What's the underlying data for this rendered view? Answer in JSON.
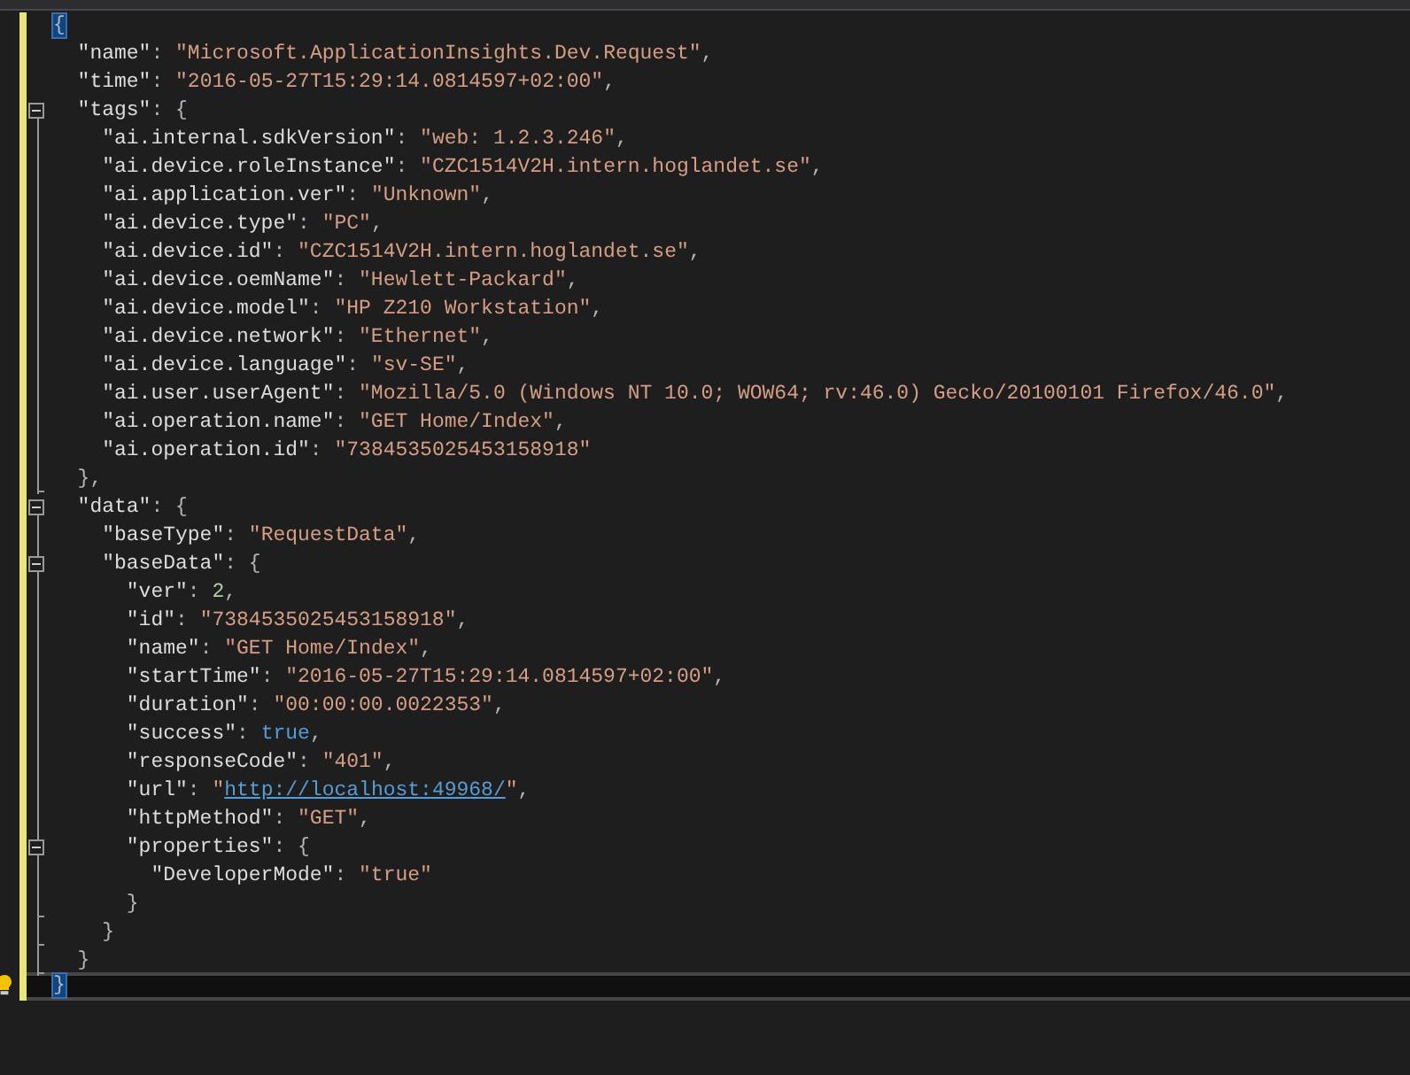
{
  "editor": {
    "root": {
      "tokens": [
        {
          "kind": "punct",
          "text": "{",
          "matched": true
        }
      ],
      "children": [
        {
          "tokens": [
            {
              "kind": "key",
              "text": "\"name\""
            },
            {
              "kind": "punct",
              "text": ": "
            },
            {
              "kind": "string",
              "text": "\"Microsoft.ApplicationInsights.Dev.Request\""
            },
            {
              "kind": "punct",
              "text": ","
            }
          ]
        },
        {
          "tokens": [
            {
              "kind": "key",
              "text": "\"time\""
            },
            {
              "kind": "punct",
              "text": ": "
            },
            {
              "kind": "string",
              "text": "\"2016-05-27T15:29:14.0814597+02:00\""
            },
            {
              "kind": "punct",
              "text": ","
            }
          ]
        },
        {
          "tokens": [
            {
              "kind": "key",
              "text": "\"tags\""
            },
            {
              "kind": "punct",
              "text": ": {"
            }
          ],
          "expanded": true,
          "children": [
            {
              "tokens": [
                {
                  "kind": "key",
                  "text": "\"ai.internal.sdkVersion\""
                },
                {
                  "kind": "punct",
                  "text": ": "
                },
                {
                  "kind": "string",
                  "text": "\"web: 1.2.3.246\""
                },
                {
                  "kind": "punct",
                  "text": ","
                }
              ]
            },
            {
              "tokens": [
                {
                  "kind": "key",
                  "text": "\"ai.device.roleInstance\""
                },
                {
                  "kind": "punct",
                  "text": ": "
                },
                {
                  "kind": "string",
                  "text": "\"CZC1514V2H.intern.hoglandet.se\""
                },
                {
                  "kind": "punct",
                  "text": ","
                }
              ]
            },
            {
              "tokens": [
                {
                  "kind": "key",
                  "text": "\"ai.application.ver\""
                },
                {
                  "kind": "punct",
                  "text": ": "
                },
                {
                  "kind": "string",
                  "text": "\"Unknown\""
                },
                {
                  "kind": "punct",
                  "text": ","
                }
              ]
            },
            {
              "tokens": [
                {
                  "kind": "key",
                  "text": "\"ai.device.type\""
                },
                {
                  "kind": "punct",
                  "text": ": "
                },
                {
                  "kind": "string",
                  "text": "\"PC\""
                },
                {
                  "kind": "punct",
                  "text": ","
                }
              ]
            },
            {
              "tokens": [
                {
                  "kind": "key",
                  "text": "\"ai.device.id\""
                },
                {
                  "kind": "punct",
                  "text": ": "
                },
                {
                  "kind": "string",
                  "text": "\"CZC1514V2H.intern.hoglandet.se\""
                },
                {
                  "kind": "punct",
                  "text": ","
                }
              ]
            },
            {
              "tokens": [
                {
                  "kind": "key",
                  "text": "\"ai.device.oemName\""
                },
                {
                  "kind": "punct",
                  "text": ": "
                },
                {
                  "kind": "string",
                  "text": "\"Hewlett-Packard\""
                },
                {
                  "kind": "punct",
                  "text": ","
                }
              ]
            },
            {
              "tokens": [
                {
                  "kind": "key",
                  "text": "\"ai.device.model\""
                },
                {
                  "kind": "punct",
                  "text": ": "
                },
                {
                  "kind": "string",
                  "text": "\"HP Z210 Workstation\""
                },
                {
                  "kind": "punct",
                  "text": ","
                }
              ]
            },
            {
              "tokens": [
                {
                  "kind": "key",
                  "text": "\"ai.device.network\""
                },
                {
                  "kind": "punct",
                  "text": ": "
                },
                {
                  "kind": "string",
                  "text": "\"Ethernet\""
                },
                {
                  "kind": "punct",
                  "text": ","
                }
              ]
            },
            {
              "tokens": [
                {
                  "kind": "key",
                  "text": "\"ai.device.language\""
                },
                {
                  "kind": "punct",
                  "text": ": "
                },
                {
                  "kind": "string",
                  "text": "\"sv-SE\""
                },
                {
                  "kind": "punct",
                  "text": ","
                }
              ]
            },
            {
              "tokens": [
                {
                  "kind": "key",
                  "text": "\"ai.user.userAgent\""
                },
                {
                  "kind": "punct",
                  "text": ": "
                },
                {
                  "kind": "string",
                  "text": "\"Mozilla/5.0 (Windows NT 10.0; WOW64; rv:46.0) Gecko/20100101 Firefox/46.0\""
                },
                {
                  "kind": "punct",
                  "text": ","
                }
              ]
            },
            {
              "tokens": [
                {
                  "kind": "key",
                  "text": "\"ai.operation.name\""
                },
                {
                  "kind": "punct",
                  "text": ": "
                },
                {
                  "kind": "string",
                  "text": "\"GET Home/Index\""
                },
                {
                  "kind": "punct",
                  "text": ","
                }
              ]
            },
            {
              "tokens": [
                {
                  "kind": "key",
                  "text": "\"ai.operation.id\""
                },
                {
                  "kind": "punct",
                  "text": ": "
                },
                {
                  "kind": "string",
                  "text": "\"7384535025453158918\""
                }
              ]
            }
          ],
          "close": {
            "tokens": [
              {
                "kind": "punct",
                "text": "},"
              }
            ]
          }
        },
        {
          "tokens": [
            {
              "kind": "key",
              "text": "\"data\""
            },
            {
              "kind": "punct",
              "text": ": {"
            }
          ],
          "expanded": true,
          "children": [
            {
              "tokens": [
                {
                  "kind": "key",
                  "text": "\"baseType\""
                },
                {
                  "kind": "punct",
                  "text": ": "
                },
                {
                  "kind": "string",
                  "text": "\"RequestData\""
                },
                {
                  "kind": "punct",
                  "text": ","
                }
              ]
            },
            {
              "tokens": [
                {
                  "kind": "key",
                  "text": "\"baseData\""
                },
                {
                  "kind": "punct",
                  "text": ": {"
                }
              ],
              "expanded": true,
              "children": [
                {
                  "tokens": [
                    {
                      "kind": "key",
                      "text": "\"ver\""
                    },
                    {
                      "kind": "punct",
                      "text": ": "
                    },
                    {
                      "kind": "number",
                      "text": "2"
                    },
                    {
                      "kind": "punct",
                      "text": ","
                    }
                  ]
                },
                {
                  "tokens": [
                    {
                      "kind": "key",
                      "text": "\"id\""
                    },
                    {
                      "kind": "punct",
                      "text": ": "
                    },
                    {
                      "kind": "string",
                      "text": "\"7384535025453158918\""
                    },
                    {
                      "kind": "punct",
                      "text": ","
                    }
                  ]
                },
                {
                  "tokens": [
                    {
                      "kind": "key",
                      "text": "\"name\""
                    },
                    {
                      "kind": "punct",
                      "text": ": "
                    },
                    {
                      "kind": "string",
                      "text": "\"GET Home/Index\""
                    },
                    {
                      "kind": "punct",
                      "text": ","
                    }
                  ]
                },
                {
                  "tokens": [
                    {
                      "kind": "key",
                      "text": "\"startTime\""
                    },
                    {
                      "kind": "punct",
                      "text": ": "
                    },
                    {
                      "kind": "string",
                      "text": "\"2016-05-27T15:29:14.0814597+02:00\""
                    },
                    {
                      "kind": "punct",
                      "text": ","
                    }
                  ]
                },
                {
                  "tokens": [
                    {
                      "kind": "key",
                      "text": "\"duration\""
                    },
                    {
                      "kind": "punct",
                      "text": ": "
                    },
                    {
                      "kind": "string",
                      "text": "\"00:00:00.0022353\""
                    },
                    {
                      "kind": "punct",
                      "text": ","
                    }
                  ]
                },
                {
                  "tokens": [
                    {
                      "kind": "key",
                      "text": "\"success\""
                    },
                    {
                      "kind": "punct",
                      "text": ": "
                    },
                    {
                      "kind": "boolean",
                      "text": "true"
                    },
                    {
                      "kind": "punct",
                      "text": ","
                    }
                  ]
                },
                {
                  "tokens": [
                    {
                      "kind": "key",
                      "text": "\"responseCode\""
                    },
                    {
                      "kind": "punct",
                      "text": ": "
                    },
                    {
                      "kind": "string",
                      "text": "\"401\""
                    },
                    {
                      "kind": "punct",
                      "text": ","
                    }
                  ]
                },
                {
                  "tokens": [
                    {
                      "kind": "key",
                      "text": "\"url\""
                    },
                    {
                      "kind": "punct",
                      "text": ": "
                    },
                    {
                      "kind": "string",
                      "text": "\""
                    },
                    {
                      "kind": "link",
                      "text": "http://localhost:49968/"
                    },
                    {
                      "kind": "string",
                      "text": "\""
                    },
                    {
                      "kind": "punct",
                      "text": ","
                    }
                  ]
                },
                {
                  "tokens": [
                    {
                      "kind": "key",
                      "text": "\"httpMethod\""
                    },
                    {
                      "kind": "punct",
                      "text": ": "
                    },
                    {
                      "kind": "string",
                      "text": "\"GET\""
                    },
                    {
                      "kind": "punct",
                      "text": ","
                    }
                  ]
                },
                {
                  "tokens": [
                    {
                      "kind": "key",
                      "text": "\"properties\""
                    },
                    {
                      "kind": "punct",
                      "text": ": {"
                    }
                  ],
                  "expanded": true,
                  "children": [
                    {
                      "tokens": [
                        {
                          "kind": "key",
                          "text": "\"DeveloperMode\""
                        },
                        {
                          "kind": "punct",
                          "text": ": "
                        },
                        {
                          "kind": "string",
                          "text": "\"true\""
                        }
                      ]
                    }
                  ],
                  "close": {
                    "tokens": [
                      {
                        "kind": "punct",
                        "text": "}"
                      }
                    ]
                  }
                }
              ],
              "close": {
                "tokens": [
                  {
                    "kind": "punct",
                    "text": "}"
                  }
                ]
              }
            }
          ],
          "close": {
            "tokens": [
              {
                "kind": "punct",
                "text": "}"
              }
            ]
          }
        }
      ],
      "close": {
        "tokens": [
          {
            "kind": "punct",
            "text": "}",
            "matched": true
          }
        ],
        "current": true
      }
    }
  }
}
